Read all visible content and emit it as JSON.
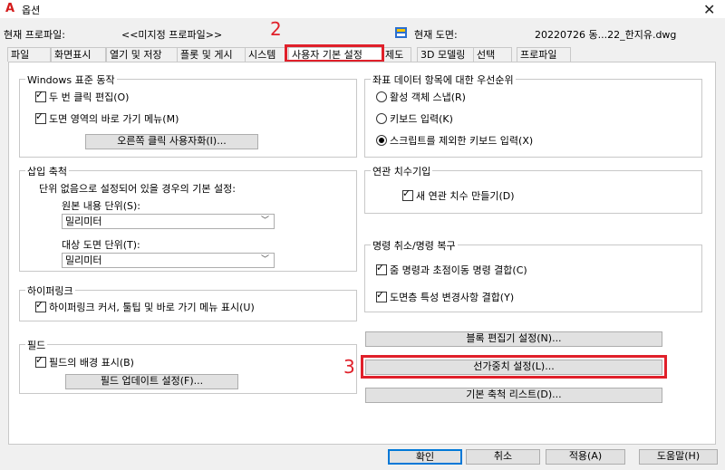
{
  "window": {
    "title": "옵션",
    "app_icon": "A"
  },
  "profile": {
    "current_profile_label": "현재 프로파일:",
    "current_profile_value": "<<미지정 프로파일>>",
    "current_drawing_label": "현재 도면:",
    "current_drawing_value": "20220726 동...22_한지유.dwg"
  },
  "tabs": [
    {
      "label": "파일"
    },
    {
      "label": "화면표시"
    },
    {
      "label": "열기 및 저장"
    },
    {
      "label": "플롯 및 게시"
    },
    {
      "label": "시스템"
    },
    {
      "label": "사용자 기본 설정"
    },
    {
      "label": "제도"
    },
    {
      "label": "3D 모델링"
    },
    {
      "label": "선택"
    },
    {
      "label": "프로파일"
    }
  ],
  "annotations": {
    "a2": "2",
    "a3": "3"
  },
  "windows_std": {
    "title": "Windows 표준 동작",
    "dbl_click": "두 번 클릭 편집(O)",
    "shortcut_menu": "도면 영역의 바로 가기 메뉴(M)",
    "right_click_btn": "오른쪽 클릭 사용자화(I)..."
  },
  "insert_scale": {
    "title": "삽입 축척",
    "desc": "단위 없음으로 설정되어 있을 경우의 기본 설정:",
    "source_label": "원본 내용 단위(S):",
    "source_value": "밀리미터",
    "target_label": "대상 도면 단위(T):",
    "target_value": "밀리미터"
  },
  "hyperlink": {
    "title": "하이퍼링크",
    "option": "하이퍼링크 커서, 툴팁 및 바로 가기 메뉴 표시(U)"
  },
  "fields": {
    "title": "필드",
    "bg": "필드의 배경 표시(B)",
    "update_btn": "필드 업데이트 설정(F)..."
  },
  "coord_priority": {
    "title": "좌표 데이터 항목에 대한 우선순위",
    "opt1": "활성 객체 스냅(R)",
    "opt2": "키보드 입력(K)",
    "opt3": "스크립트를 제외한 키보드 입력(X)",
    "selected": 3
  },
  "assoc_dim": {
    "title": "연관 치수기입",
    "option": "새 연관 치수 만들기(D)"
  },
  "undo_redo": {
    "title": "명령 취소/명령 복구",
    "opt1": "줌 명령과 초점이동 명령 결합(C)",
    "opt2": "도면층 특성 변경사항 결합(Y)"
  },
  "right_buttons": {
    "block_editor": "블록 편집기 설정(N)...",
    "lineweight": "선가중치 설정(L)...",
    "scale_list": "기본 축척 리스트(D)..."
  },
  "footer": {
    "ok": "확인",
    "cancel": "취소",
    "apply": "적용(A)",
    "help": "도움말(H)"
  },
  "colors": {
    "accent": "#e0202a",
    "focus": "#0078d7"
  }
}
